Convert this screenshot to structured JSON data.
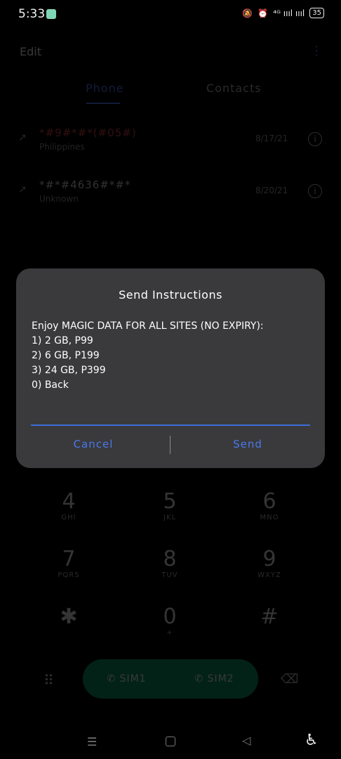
{
  "status_bar": {
    "time": "5:33",
    "signal_text": "⁴ᴳ ıııl ıııl",
    "battery": "35"
  },
  "background": {
    "edit_label": "Edit",
    "tabs": [
      {
        "label": "Phone",
        "active": true
      },
      {
        "label": "Contacts",
        "active": false
      }
    ],
    "calls": [
      {
        "number": "*#9#*#*(#05#)",
        "sub": "Philippines",
        "date": "8/17/21",
        "missed": true
      },
      {
        "number": "*#*#4636#*#*",
        "sub": "Unknown",
        "date": "8/20/21",
        "missed": false
      }
    ],
    "keys": [
      {
        "digit": "4",
        "letters": "GHI"
      },
      {
        "digit": "5",
        "letters": "JKL"
      },
      {
        "digit": "6",
        "letters": "MNO"
      },
      {
        "digit": "7",
        "letters": "PQRS"
      },
      {
        "digit": "8",
        "letters": "TUV"
      },
      {
        "digit": "9",
        "letters": "WXYZ"
      },
      {
        "digit": "✱",
        "letters": ""
      },
      {
        "digit": "0",
        "letters": "+"
      },
      {
        "digit": "#",
        "letters": ""
      }
    ],
    "sim1_label": "SIM1",
    "sim2_label": "SIM2"
  },
  "dialog": {
    "title": "Send Instructions",
    "lines": [
      "Enjoy MAGIC DATA FOR ALL SITES (NO EXPIRY):",
      "1) 2 GB, P99",
      "2) 6 GB, P199",
      "3) 24 GB, P399",
      "0) Back"
    ],
    "input_value": "",
    "cancel_label": "Cancel",
    "send_label": "Send"
  },
  "colors": {
    "accent": "#4a78ea",
    "dialog_bg": "#3a3a3c",
    "call_button": "#0f9c6a"
  }
}
